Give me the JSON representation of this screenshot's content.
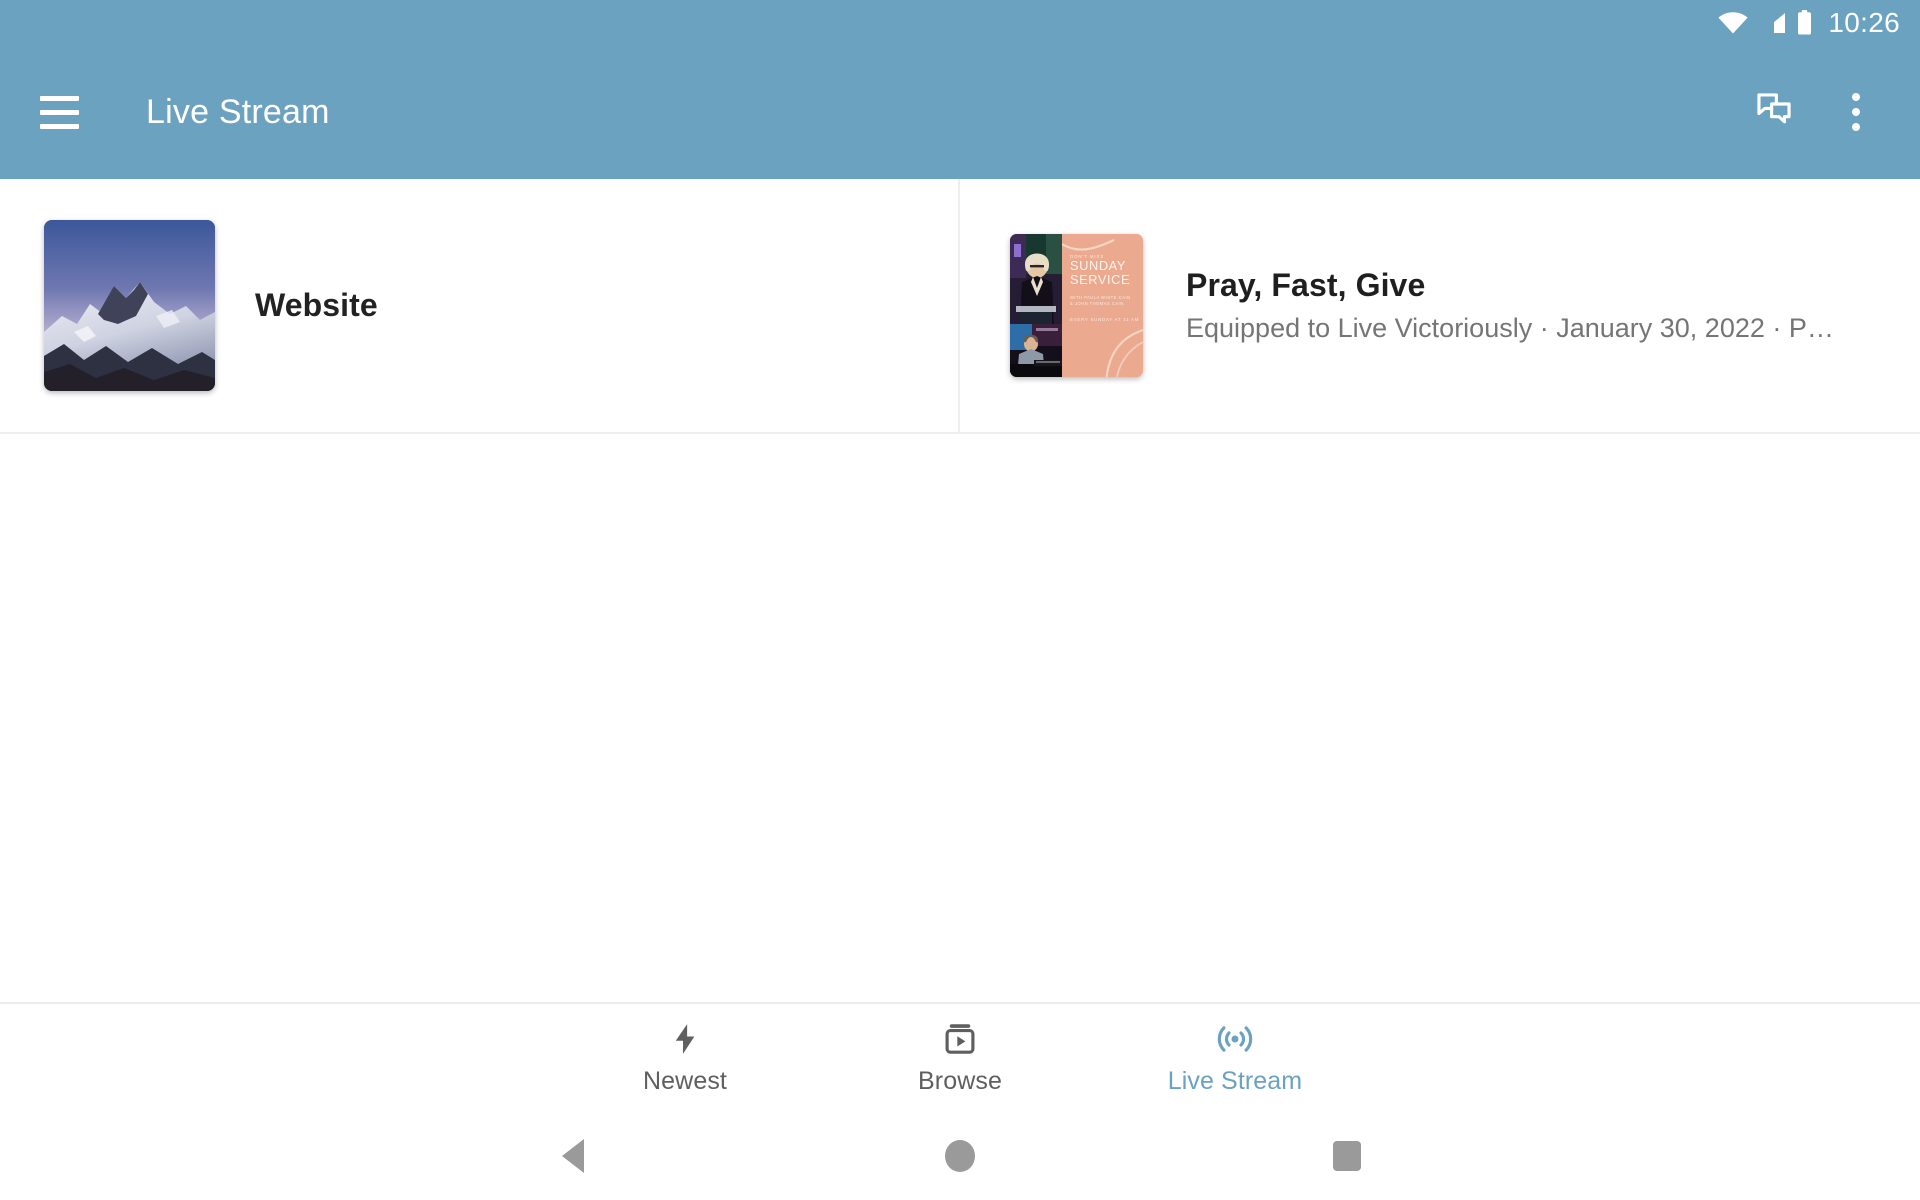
{
  "status_bar": {
    "time": "10:26",
    "icons": [
      "wifi-icon",
      "cellular-signal-icon",
      "battery-icon"
    ]
  },
  "app_bar": {
    "menu_icon": "hamburger-menu-icon",
    "title": "Live Stream",
    "actions": [
      {
        "icon": "chat-bubbles-icon",
        "name": "chat-button"
      },
      {
        "icon": "overflow-menu-icon",
        "name": "overflow-menu-button"
      }
    ],
    "background_color": "#6BA2C0"
  },
  "cards": [
    {
      "type": "website",
      "title": "Website",
      "thumbnail": "snowy-mountain-photo"
    },
    {
      "type": "sermon",
      "title": "Pray, Fast, Give",
      "meta": "Equipped to Live Victoriously · January 30, 2022 · P…",
      "thumbnail": "sunday-service-poster",
      "thumbnail_text": {
        "kicker": "DON'T MISS",
        "headline_line1": "SUNDAY",
        "headline_line2": "SERVICE",
        "subline": "WITH PAULA WHITE-CAIN\n& JOHN THOMAS CAIN",
        "footer": "EVERY SUNDAY AT 11 AM"
      },
      "thumbnail_color": "#EBA98F"
    }
  ],
  "bottom_nav": {
    "active_color": "#6BA2C0",
    "inactive_color": "#5F5F5F",
    "items": [
      {
        "label": "Newest",
        "icon": "lightning-bolt-icon",
        "active": false
      },
      {
        "label": "Browse",
        "icon": "subscriptions-icon",
        "active": false
      },
      {
        "label": "Live Stream",
        "icon": "broadcast-waves-icon",
        "active": true
      }
    ]
  },
  "system_nav": {
    "back": "back-triangle-icon",
    "home": "home-circle-icon",
    "recents": "recents-square-icon"
  }
}
